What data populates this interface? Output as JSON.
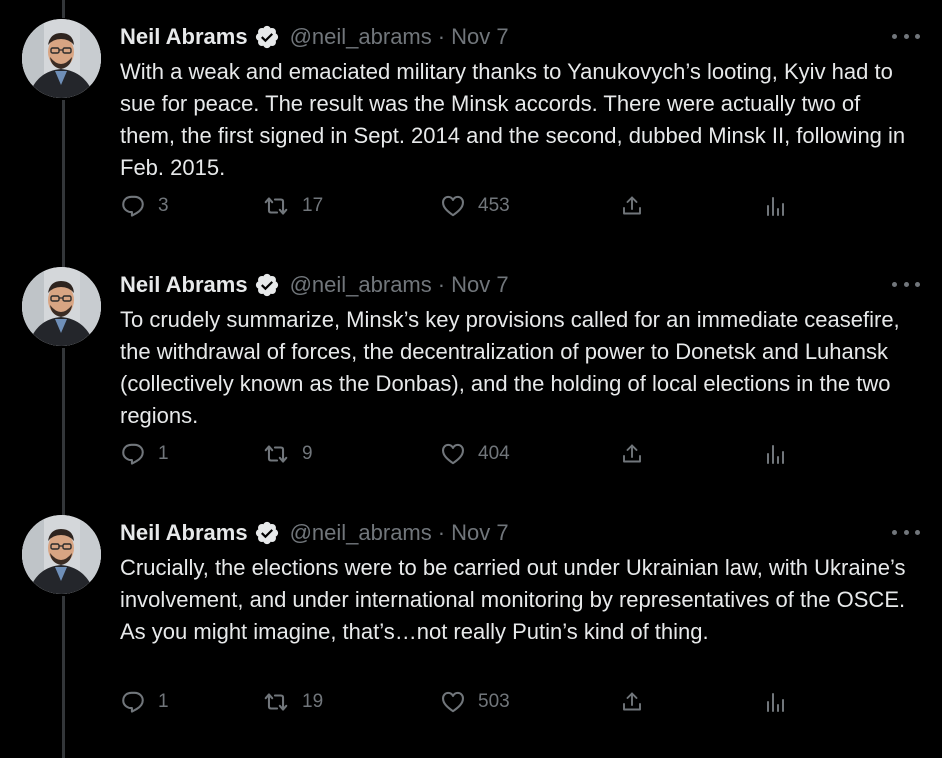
{
  "colors": {
    "background": "#000000",
    "text_primary": "#e7e9ea",
    "text_secondary": "#71767b",
    "verified_badge": "#e7e9ea",
    "thread_line": "#333639"
  },
  "icons": {
    "verified": "verified-badge-icon",
    "more": "more-options-icon",
    "reply": "reply-icon",
    "retweet": "retweet-icon",
    "like": "heart-icon",
    "share": "share-icon",
    "analytics": "analytics-icon"
  },
  "tweets": [
    {
      "author_name": "Neil Abrams",
      "handle": "@neil_abrams",
      "separator": "·",
      "date": "Nov 7",
      "text": "With a weak and emaciated military thanks to Yanukovych’s looting, Kyiv had to sue for peace.  The result was the Minsk accords.  There were actually two of them, the first signed in Sept. 2014 and the second, dubbed Minsk II, following in Feb. 2015.",
      "replies": "3",
      "retweets": "17",
      "likes": "453"
    },
    {
      "author_name": "Neil Abrams",
      "handle": "@neil_abrams",
      "separator": "·",
      "date": "Nov 7",
      "text": "To crudely summarize, Minsk’s key provisions called for an immediate ceasefire, the withdrawal of forces, the decentralization of power to Donetsk and Luhansk (collectively known as the Donbas), and the holding of local elections in the two regions.",
      "replies": "1",
      "retweets": "9",
      "likes": "404"
    },
    {
      "author_name": "Neil Abrams",
      "handle": "@neil_abrams",
      "separator": "·",
      "date": "Nov 7",
      "text": "Crucially, the elections were to be carried out under Ukrainian law, with Ukraine’s involvement, and under international monitoring by representatives of the OSCE.  As you might imagine, that’s…not really Putin’s kind of thing.",
      "replies": "1",
      "retweets": "19",
      "likes": "503"
    }
  ]
}
